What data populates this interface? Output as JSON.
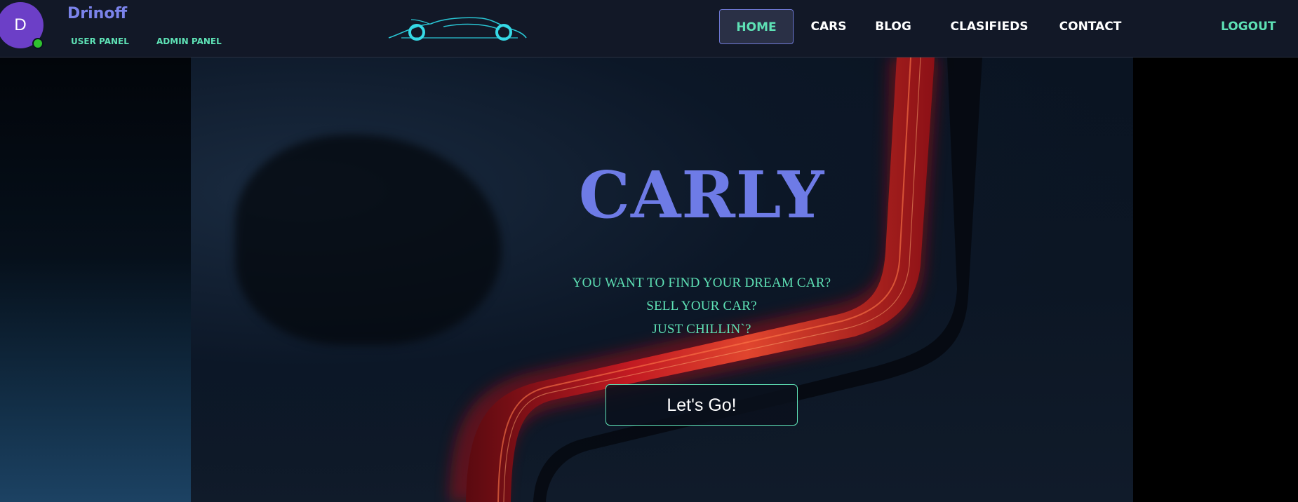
{
  "user": {
    "initial": "D",
    "name": "Drinoff",
    "links": {
      "user_panel": "USER PANEL",
      "admin_panel": "ADMIN PANEL"
    }
  },
  "logo": {
    "icon": "sports-car-icon"
  },
  "nav": {
    "items": [
      {
        "label": "HOME",
        "active": true
      },
      {
        "label": "CARS"
      },
      {
        "label": "BLOG"
      },
      {
        "label": "CLASIFIEDS"
      },
      {
        "label": "CONTACT"
      }
    ],
    "logout": "LOGOUT"
  },
  "hero": {
    "brand": "CARLY",
    "taglines": [
      "YOU WANT TO FIND YOUR DREAM CAR?",
      "SELL YOUR CAR?",
      "JUST CHILLIN`?"
    ],
    "cta": "Let's Go!"
  },
  "colors": {
    "navbar_bg": "#121827",
    "accent_mint": "#5ee1b5",
    "accent_indigo": "#6e7be6",
    "avatar_purple": "#6c3fc7",
    "online_green": "#2fc22f",
    "tail_light_red": "#c21a22"
  }
}
